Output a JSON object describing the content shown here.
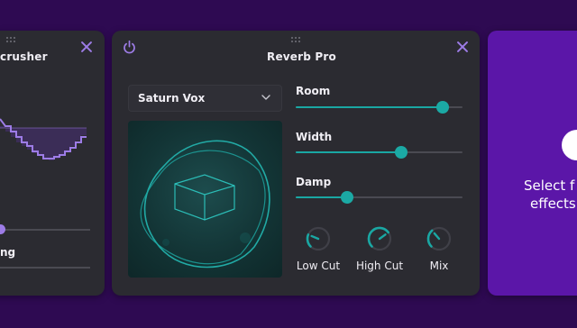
{
  "left_panel": {
    "title": "crusher",
    "bottom_label": "ng",
    "accent": "#9d7ce6"
  },
  "main_panel": {
    "title": "Reverb Pro",
    "preset": {
      "selected": "Saturn Vox"
    },
    "sliders": [
      {
        "label": "Room",
        "value": 0.88
      },
      {
        "label": "Width",
        "value": 0.63
      },
      {
        "label": "Damp",
        "value": 0.31
      }
    ],
    "knobs": [
      {
        "label": "Low Cut",
        "value": 0.25
      },
      {
        "label": "High Cut",
        "value": 0.7
      },
      {
        "label": "Mix",
        "value": 0.35
      }
    ],
    "accent": "#1aa7a3"
  },
  "right_panel": {
    "line1": "Select f",
    "line2": "effects"
  },
  "icons": [
    "power-icon",
    "close-icon",
    "drag-handle-icon",
    "chevron-down-icon",
    "cube-icon"
  ]
}
